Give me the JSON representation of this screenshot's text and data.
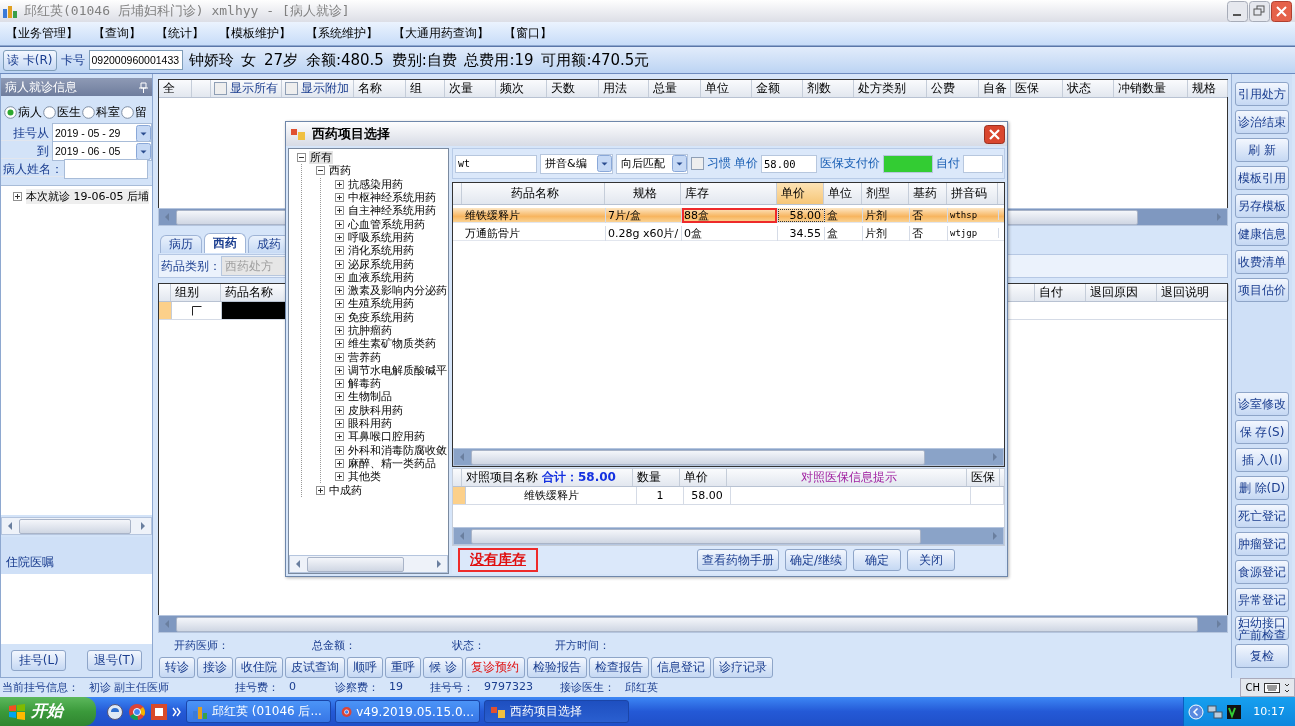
{
  "window": {
    "title": "邱红英(01046 后埔妇科门诊) xmlhyy - [病人就诊]"
  },
  "menu": [
    "【业务管理】",
    "【查询】",
    "【统计】",
    "【模板维护】",
    "【系统维护】",
    "【大通用药查询】",
    "【窗口】"
  ],
  "patient_bar": {
    "read_card_button": "读 卡(R)",
    "card_label": "卡号",
    "card_number": "092000960001433",
    "info": "钟娇玲 女 27岁 余额:480.5 费别:自费 总费用:19 可用额:470.5元"
  },
  "left_panel": {
    "title": "病人就诊信息",
    "filter_options": [
      {
        "label": "病人",
        "selected": true
      },
      {
        "label": "医生",
        "selected": false
      },
      {
        "label": "科室",
        "selected": false
      },
      {
        "label": "留",
        "selected": false
      }
    ],
    "date_from_label": "挂号从",
    "date_from": "2019 - 05 - 29",
    "date_to_label": "到",
    "date_to": "2019 - 06 - 05",
    "name_label": "病人姓名：",
    "visits": [
      {
        "label": "本次就诊 19-06-05 后埔",
        "expanded": false
      }
    ],
    "inpatient_title": "住院医嘱",
    "buttons": [
      "挂号(L)",
      "退号(T)"
    ]
  },
  "prescription_table": {
    "first_columns": [
      "全",
      ""
    ],
    "header_options": [
      {
        "label": "显示所有",
        "checked": false
      },
      {
        "label": "显示附加",
        "checked": false
      }
    ],
    "columns": [
      "名称",
      "组",
      "次量",
      "频次",
      "天数",
      "用法",
      "总量",
      "单位",
      "金额",
      "剂数",
      "处方类别",
      "公费",
      "自备",
      "医保",
      "状态",
      "冲销数量",
      "规格"
    ]
  },
  "tabs": [
    {
      "label": "病历",
      "selected": false
    },
    {
      "label": "西药",
      "selected": true
    },
    {
      "label": "成药",
      "selected": false
    }
  ],
  "category": {
    "label": "药品类别：",
    "value": "西药处方",
    "disabled": true
  },
  "order_table": {
    "left_columns": [
      "组别",
      "药品名称"
    ],
    "right_columns": [
      "",
      "自付",
      "退回原因",
      "退回说明"
    ],
    "rows": [
      {
        "checked": false,
        "selected": true
      }
    ]
  },
  "summary_labels": [
    "开药医师：",
    "总金额：",
    "状态：",
    "开方时间："
  ],
  "action_buttons": [
    {
      "label": "转诊",
      "kind": "normal"
    },
    {
      "label": "接诊",
      "kind": "normal"
    },
    {
      "label": "收住院",
      "kind": "normal"
    },
    {
      "label": "皮试查询",
      "kind": "normal"
    },
    {
      "label": "顺呼",
      "kind": "normal"
    },
    {
      "label": "重呼",
      "kind": "normal"
    },
    {
      "label": "候 诊",
      "kind": "normal"
    },
    {
      "label": "复诊预约",
      "kind": "alert"
    },
    {
      "label": "检验报告",
      "kind": "normal"
    },
    {
      "label": "检查报告",
      "kind": "normal"
    },
    {
      "label": "信息登记",
      "kind": "normal"
    },
    {
      "label": "诊疗记录",
      "kind": "normal"
    }
  ],
  "right_buttons_top": [
    "引用处方",
    "诊治结束",
    "刷 新",
    "模板引用",
    "另存模板",
    "健康信息",
    "收费清单",
    "项目估价"
  ],
  "right_buttons_bottom": [
    "诊室修改",
    "保 存(S)",
    "插 入(I)",
    "删 除(D)",
    "死亡登记",
    "肿瘤登记",
    "食源登记",
    "异常登记",
    "妇幼接口产前检查",
    "复检"
  ],
  "status_bar": [
    {
      "label": "当前挂号信息：",
      "value": "初诊 副主任医师"
    },
    {
      "label": "挂号费：",
      "value": "0"
    },
    {
      "label": "诊察费：",
      "value": "19"
    },
    {
      "label": "挂号号：",
      "value": "9797323"
    },
    {
      "label": "接诊医生：",
      "value": "邱红英"
    }
  ],
  "language_bar": {
    "label": "CH"
  },
  "dialog": {
    "title": "西药项目选择",
    "tree": {
      "label": "所有",
      "expanded": true,
      "selected": true,
      "children": [
        {
          "label": "西药",
          "expanded": true,
          "selected": false,
          "children": [
            {
              "label": "抗感染用药",
              "expanded": false,
              "selected": false
            },
            {
              "label": "中枢神经系统用药",
              "expanded": false,
              "selected": false
            },
            {
              "label": "自主神经系统用药",
              "expanded": false,
              "selected": false
            },
            {
              "label": "心血管系统用药",
              "expanded": false,
              "selected": false
            },
            {
              "label": "呼吸系统用药",
              "expanded": false,
              "selected": false
            },
            {
              "label": "消化系统用药",
              "expanded": false,
              "selected": false
            },
            {
              "label": "泌尿系统用药",
              "expanded": false,
              "selected": false
            },
            {
              "label": "血液系统用药",
              "expanded": false,
              "selected": false
            },
            {
              "label": "激素及影响内分泌药",
              "expanded": false,
              "selected": false
            },
            {
              "label": "生殖系统用药",
              "expanded": false,
              "selected": false
            },
            {
              "label": "免疫系统用药",
              "expanded": false,
              "selected": false
            },
            {
              "label": "抗肿瘤药",
              "expanded": false,
              "selected": false
            },
            {
              "label": "维生素矿物质类药",
              "expanded": false,
              "selected": false
            },
            {
              "label": "营养药",
              "expanded": false,
              "selected": false
            },
            {
              "label": "调节水电解质酸碱平",
              "expanded": false,
              "selected": false
            },
            {
              "label": "解毒药",
              "expanded": false,
              "selected": false
            },
            {
              "label": "生物制品",
              "expanded": false,
              "selected": false
            },
            {
              "label": "皮肤科用药",
              "expanded": false,
              "selected": false
            },
            {
              "label": "眼科用药",
              "expanded": false,
              "selected": false
            },
            {
              "label": "耳鼻喉口腔用药",
              "expanded": false,
              "selected": false
            },
            {
              "label": "外科和消毒防腐收敛",
              "expanded": false,
              "selected": false
            },
            {
              "label": "麻醉、精一类药品",
              "expanded": false,
              "selected": false
            },
            {
              "label": "其他类",
              "expanded": false,
              "selected": false
            }
          ]
        },
        {
          "label": "中成药",
          "expanded": false,
          "selected": false
        }
      ]
    },
    "search": "wt",
    "match_mode": "拼音&编",
    "match_direction": "向后匹配",
    "habit": {
      "label": "习惯",
      "checked": false
    },
    "price_label": "单价",
    "price": "58.00",
    "insurance_label": "医保支付价",
    "self_pay_label": "自付",
    "drug_table": {
      "columns": [
        {
          "label": "药品名称",
          "sorted": false
        },
        {
          "label": "规格",
          "sorted": false
        },
        {
          "label": "库存",
          "sorted": false
        },
        {
          "label": "单价",
          "sorted": true
        },
        {
          "label": "单位",
          "sorted": false
        },
        {
          "label": "剂型",
          "sorted": false
        },
        {
          "label": "基药",
          "sorted": false
        },
        {
          "label": "拼音码",
          "sorted": false
        }
      ],
      "rows": [
        {
          "cells": [
            "维铁缓释片",
            "7片/盒",
            "88盒",
            "58.00",
            "盒",
            "片剂",
            "否",
            "wthsp"
          ],
          "selected": true,
          "stock_flagged": true
        },
        {
          "cells": [
            "万通筋骨片",
            "0.28g x60片/",
            "0盒",
            "34.55",
            "盒",
            "片剂",
            "否",
            "wtjgp"
          ],
          "selected": false,
          "stock_flagged": false
        }
      ]
    },
    "compare_table": {
      "total": "合计：58.00",
      "columns": [
        "对照项目名称",
        "数量",
        "单价",
        "对照医保信息提示",
        "医保"
      ],
      "rows": [
        {
          "cells": [
            "维铁缓释片",
            "1",
            "58.00"
          ],
          "selected": true
        }
      ]
    },
    "message": "没有库存",
    "buttons": [
      "查看药物手册",
      "确定/继续",
      "确定",
      "关闭"
    ]
  },
  "taskbar": {
    "start": "开始",
    "tasks": [
      {
        "label": "邱红英 (01046 后...",
        "selected": false
      },
      {
        "label": "v49.2019.05.15.0...",
        "selected": false
      },
      {
        "label": "西药项目选择",
        "selected": true
      }
    ],
    "time": "10:17"
  }
}
